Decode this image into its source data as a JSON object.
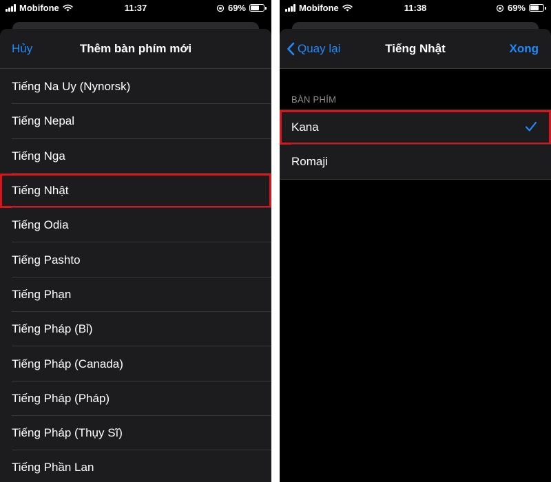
{
  "left_screen": {
    "status": {
      "carrier": "Mobifone",
      "time": "11:37",
      "battery": "69%",
      "battery_level": 0.69
    },
    "nav": {
      "cancel_label": "Hủy",
      "title": "Thêm bàn phím mới"
    },
    "languages": [
      {
        "label": "Tiếng Na Uy (Nynorsk)"
      },
      {
        "label": "Tiếng Nepal"
      },
      {
        "label": "Tiếng Nga"
      },
      {
        "label": "Tiếng Nhật",
        "highlighted": true
      },
      {
        "label": "Tiếng Odia"
      },
      {
        "label": "Tiếng Pashto"
      },
      {
        "label": "Tiếng Phạn"
      },
      {
        "label": "Tiếng Pháp (Bỉ)"
      },
      {
        "label": "Tiếng Pháp (Canada)"
      },
      {
        "label": "Tiếng Pháp (Pháp)"
      },
      {
        "label": "Tiếng Pháp (Thụy Sĩ)"
      },
      {
        "label": "Tiếng Phần Lan"
      }
    ]
  },
  "right_screen": {
    "status": {
      "carrier": "Mobifone",
      "time": "11:38",
      "battery": "69%",
      "battery_level": 0.69
    },
    "nav": {
      "back_label": "Quay lại",
      "title": "Tiếng Nhật",
      "done_label": "Xong"
    },
    "section_header": "BÀN PHÍM",
    "keyboards": [
      {
        "label": "Kana",
        "selected": true,
        "highlighted": true
      },
      {
        "label": "Romaji",
        "selected": false
      }
    ]
  },
  "colors": {
    "accent": "#1f8bff",
    "highlight": "#d9141c",
    "background": "#000000",
    "surface": "#1c1c1e"
  }
}
